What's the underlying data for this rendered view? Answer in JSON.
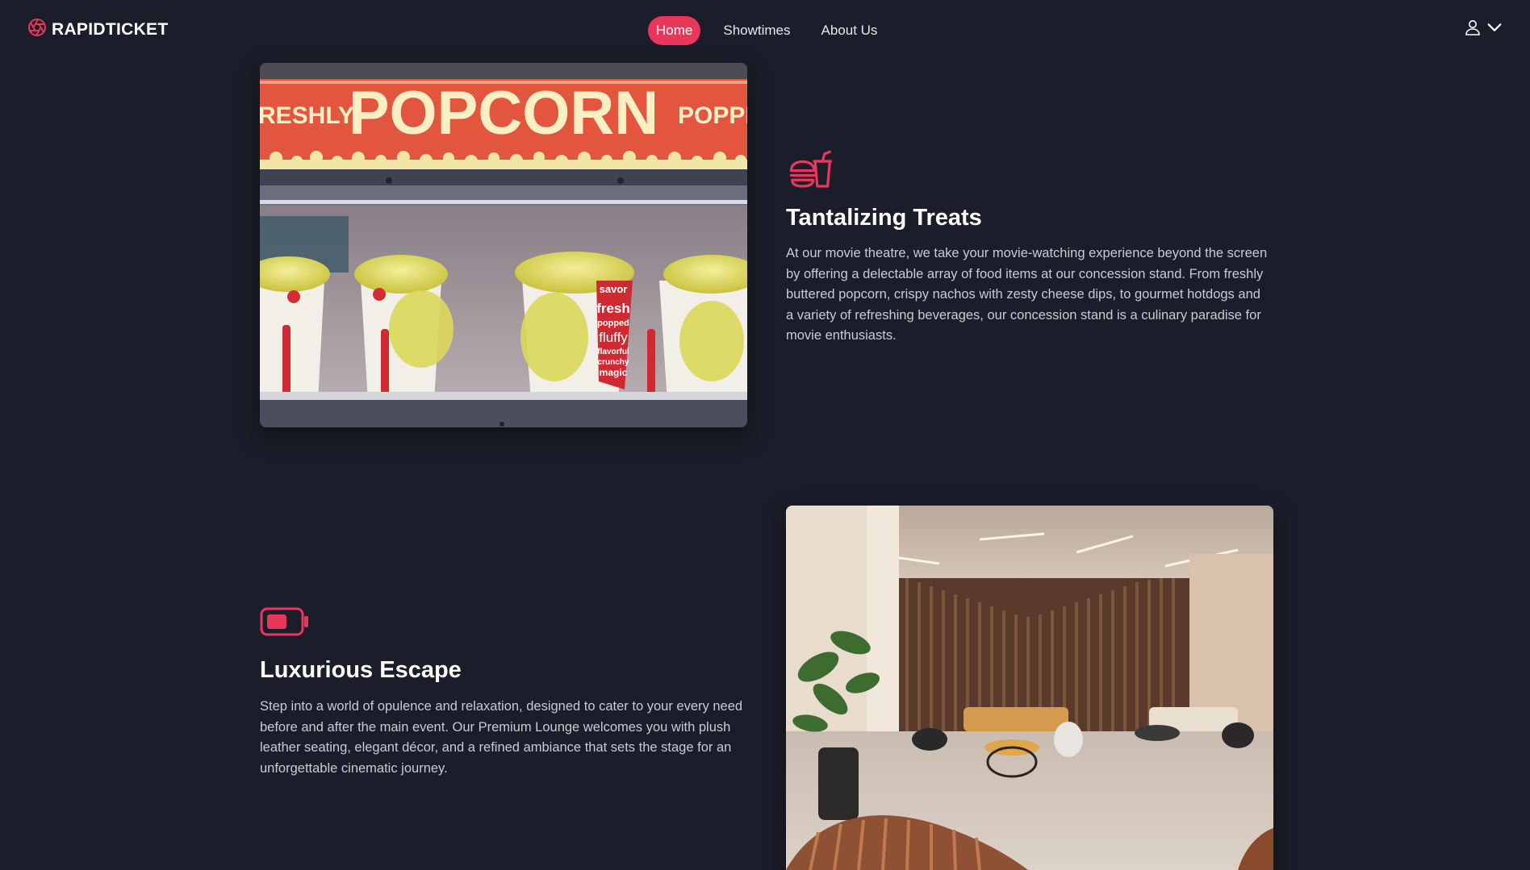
{
  "brand": {
    "name": "RAPIDTICKET",
    "logo_icon": "aperture-logo-icon",
    "accent": "#e8375b"
  },
  "nav": {
    "links": [
      {
        "label": "Home",
        "active": true
      },
      {
        "label": "Showtimes",
        "active": false
      },
      {
        "label": "About Us",
        "active": false
      }
    ]
  },
  "user_menu": {
    "icon": "user-icon",
    "chevron": "chevron-down-icon"
  },
  "sections": {
    "treats": {
      "icon": "fastfood-icon",
      "title": "Tantalizing Treats",
      "text": "At our movie theatre, we take your movie-watching experience beyond the screen by offering a delectable array of food items at our concession stand. From freshly buttered popcorn, crispy nachos with zesty cheese dips, to gourmet hotdogs and a variety of refreshing beverages, our concession stand is a culinary paradise for movie enthusiasts.",
      "image_sign": "POPCORN",
      "image_sign_left": "RESHLY",
      "image_sign_right": "POPPED",
      "image_cup_text": [
        "savor",
        "fresh",
        "popped",
        "fluffy",
        "flavorful",
        "crunchy",
        "magic"
      ]
    },
    "luxury": {
      "icon": "battery-icon",
      "title": "Luxurious Escape",
      "text": "Step into a world of opulence and relaxation, designed to cater to your every need before and after the main event. Our Premium Lounge welcomes you with plush leather seating, elegant décor, and a refined ambiance that sets the stage for an unforgettable cinematic journey."
    }
  },
  "colors": {
    "background": "#1b1d2a",
    "accent": "#e8375b",
    "body_text": "#c9cad3"
  }
}
